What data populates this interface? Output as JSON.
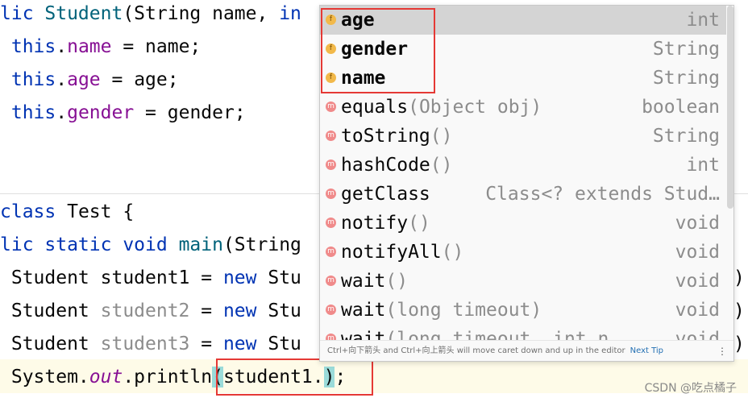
{
  "code": {
    "line1": {
      "a": "lic ",
      "b": "Student",
      "c": "(String name, ",
      "d": "in"
    },
    "line2": {
      "a": " this",
      "b": ".",
      "c": "name",
      "d": " = name;"
    },
    "line3": {
      "a": " this",
      "b": ".",
      "c": "age",
      "d": " = age;"
    },
    "line4": {
      "a": " this",
      "b": ".",
      "c": "gender",
      "d": " = gender;"
    },
    "line5": {
      "a": "class",
      "b": " Test {"
    },
    "line6": {
      "a": "lic static void ",
      "b": "main",
      "c": "(String"
    },
    "line7": {
      "a": " Student student1 = ",
      "b": "new",
      "c": " Stu"
    },
    "line8": {
      "a": " Student ",
      "b": "student2",
      "c": " = ",
      "d": "new",
      "e": " Stu"
    },
    "line9": {
      "a": " Student ",
      "b": "student3",
      "c": " = ",
      "d": "new",
      "e": " Stu"
    },
    "line10": {
      "a": " System.",
      "b": "out",
      "c": ".printl",
      "d": "n",
      "e": "(",
      "f": "student1.",
      "g": ")",
      "h": ";"
    },
    "right_paren": ")"
  },
  "completion": {
    "items": [
      {
        "icon": "f",
        "name": "age",
        "params": "",
        "type": "int",
        "bold": true,
        "selected": true
      },
      {
        "icon": "f",
        "name": "gender",
        "params": "",
        "type": "String",
        "bold": true
      },
      {
        "icon": "f",
        "name": "name",
        "params": "",
        "type": "String",
        "bold": true
      },
      {
        "icon": "m",
        "name": "equals",
        "params": "(Object obj)",
        "type": "boolean"
      },
      {
        "icon": "m",
        "name": "toString",
        "params": "()",
        "type": "String"
      },
      {
        "icon": "m",
        "name": "hashCode",
        "params": "()",
        "type": "int"
      },
      {
        "icon": "m",
        "name": "getClass",
        "params": "",
        "type": "Class<? extends Stud…"
      },
      {
        "icon": "m",
        "name": "notify",
        "params": "()",
        "type": "void"
      },
      {
        "icon": "m",
        "name": "notifyAll",
        "params": "()",
        "type": "void"
      },
      {
        "icon": "m",
        "name": "wait",
        "params": "()",
        "type": "void"
      },
      {
        "icon": "m",
        "name": "wait",
        "params": "(long timeout)",
        "type": "void"
      },
      {
        "icon": "m",
        "name": "wait",
        "params": "(long timeout, int n",
        "type": "void"
      }
    ],
    "footer": "Ctrl+向下箭头 and Ctrl+向上箭头 will move caret down and up in the editor",
    "footer_link": "Next Tip",
    "more_icon": "⋮"
  },
  "watermark": "CSDN @吃点橘子"
}
